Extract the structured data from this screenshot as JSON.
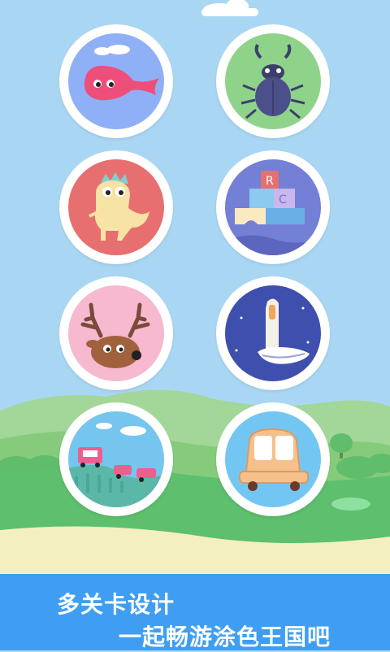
{
  "levels": [
    {
      "name": "whale",
      "bg": "#8fb0f6"
    },
    {
      "name": "beetle",
      "bg": "#8fd38a"
    },
    {
      "name": "dinosaur",
      "bg": "#e86f6f"
    },
    {
      "name": "blocks",
      "bg": "#7480d6"
    },
    {
      "name": "deer",
      "bg": "#f7b9cf"
    },
    {
      "name": "rocket",
      "bg": "#3e4fae"
    },
    {
      "name": "roller-coaster",
      "bg": "#75c5ef"
    },
    {
      "name": "car",
      "bg": "#74c6f2"
    }
  ],
  "banner": {
    "line1": "多关卡设计",
    "line2": "一起畅游涂色王国吧",
    "color": "#3f9ef1"
  },
  "colors": {
    "sky": "#a9d7f3",
    "hill_green": "#8ccd7e",
    "grass": "#5ebf6e",
    "sand": "#f4efc0"
  }
}
